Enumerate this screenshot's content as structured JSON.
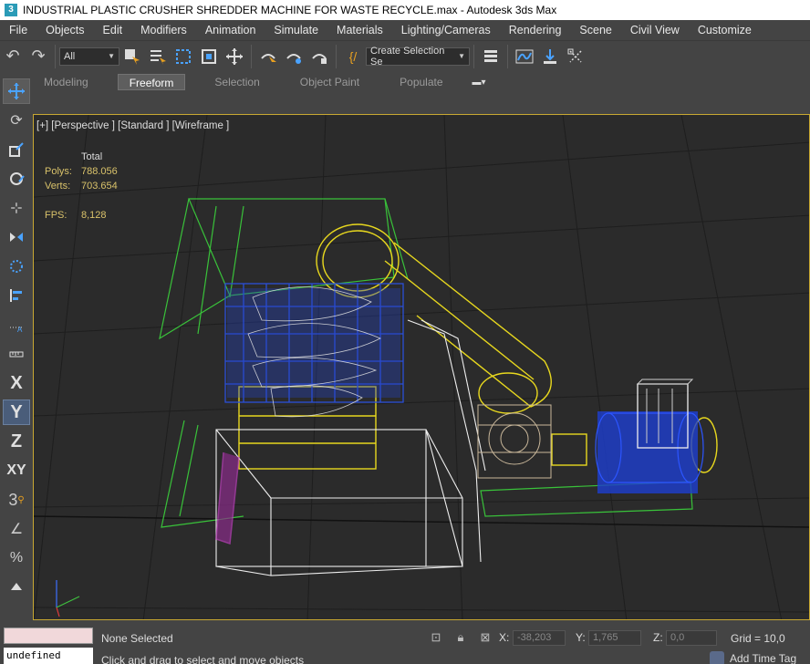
{
  "window": {
    "title": "INDUSTRIAL PLASTIC CRUSHER SHREDDER MACHINE FOR WASTE RECYCLE.max - Autodesk 3ds Max",
    "app_icon_label": "3"
  },
  "menu": [
    "File",
    "Objects",
    "Edit",
    "Modifiers",
    "Animation",
    "Simulate",
    "Materials",
    "Lighting/Cameras",
    "Rendering",
    "Scene",
    "Civil View",
    "Customize"
  ],
  "toolbar": {
    "filter_value": "All",
    "selection_set_placeholder": "Create Selection Se"
  },
  "ribbon": {
    "tabs": [
      "Modeling",
      "Freeform",
      "Selection",
      "Object Paint",
      "Populate"
    ],
    "active_tab": "Freeform"
  },
  "left_strip": {
    "axis_x": "X",
    "axis_y": "Y",
    "axis_z": "Z",
    "axis_xy": "XY"
  },
  "viewport": {
    "label": "[+] [Perspective ] [Standard ] [Wireframe ]",
    "stats": {
      "header": "Total",
      "polys_label": "Polys:",
      "polys_value": "788.056",
      "verts_label": "Verts:",
      "verts_value": "703.654",
      "fps_label": "FPS:",
      "fps_value": "8,128"
    }
  },
  "status": {
    "command_output": "undefined",
    "selection": "None Selected",
    "prompt": "Click and drag to select and move objects",
    "x_label": "X:",
    "x_value": "-38,203",
    "y_label": "Y:",
    "y_value": "1,765",
    "z_label": "Z:",
    "z_value": "0,0",
    "grid": "Grid = 10,0",
    "time_tag": "Add Time Tag"
  },
  "colors": {
    "viewport_bg": "#2b2b2b",
    "active_border": "#c8a832",
    "stats_text": "#d9c26a"
  }
}
